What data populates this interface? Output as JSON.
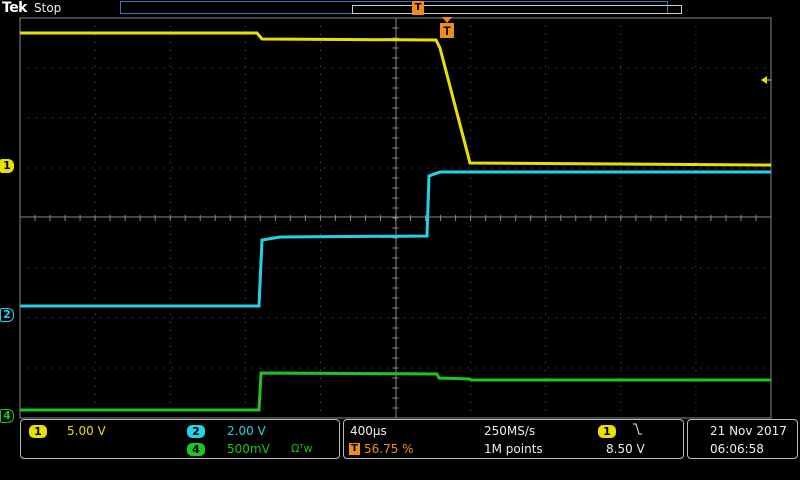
{
  "header": {
    "brand": "Tek",
    "acq_state": "Stop"
  },
  "channels": [
    {
      "id": "1",
      "color": "#e8e000",
      "scale": "5.00 V"
    },
    {
      "id": "2",
      "color": "#22d3e6",
      "scale": "2.00 V"
    },
    {
      "id": "4",
      "color": "#1ec51e",
      "scale": "500mV",
      "extra": "Ωᵀw"
    }
  ],
  "timebase": {
    "horizontal_scale": "400µs",
    "sample_rate": "250MS/s",
    "trigger_position": "56.75 %",
    "record_length": "1M points"
  },
  "trigger": {
    "source": "1",
    "slope_icon": "falling-edge-icon",
    "level": "8.50 V",
    "marker": "T"
  },
  "datetime": {
    "date": "21 Nov 2017",
    "time": "06:06:58"
  },
  "colors": {
    "trigger_orange": "#f08c1c",
    "graticule": "#888888"
  }
}
